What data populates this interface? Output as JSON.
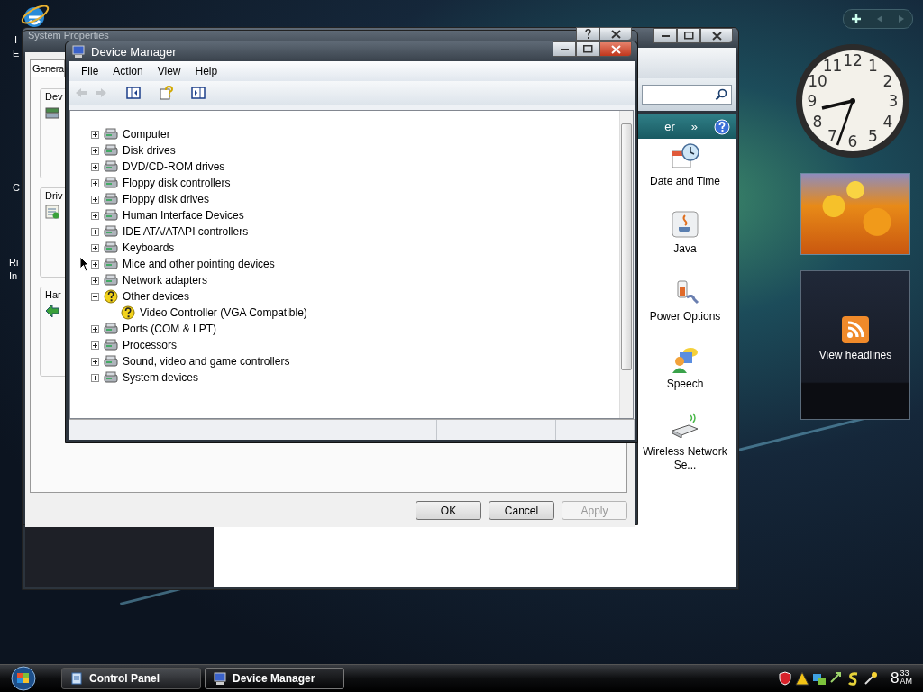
{
  "desktop": {
    "icon_labels": [
      "I",
      "E",
      "C",
      "Ri",
      "In"
    ]
  },
  "control_panel": {
    "header_text": "er",
    "header_chevron": "»",
    "items": [
      "Date and Time",
      "Java",
      "Power Options",
      "Speech",
      "Wireless Network Se..."
    ]
  },
  "system_properties": {
    "title": "System Properties",
    "tabs": [
      {
        "label": "Genera",
        "selected": true
      }
    ],
    "groups": [
      "Dev",
      "Driv",
      "Har"
    ],
    "buttons": [
      {
        "label": "OK",
        "disabled": false
      },
      {
        "label": "Cancel",
        "disabled": false
      },
      {
        "label": "Apply",
        "disabled": true
      }
    ]
  },
  "device_manager": {
    "title": "Device Manager",
    "menu": [
      "File",
      "Action",
      "View",
      "Help"
    ],
    "tree": [
      {
        "label": "Computer",
        "kind": "device",
        "expanded": false
      },
      {
        "label": "Disk drives",
        "kind": "device",
        "expanded": false
      },
      {
        "label": "DVD/CD-ROM drives",
        "kind": "device",
        "expanded": false
      },
      {
        "label": "Floppy disk controllers",
        "kind": "device",
        "expanded": false
      },
      {
        "label": "Floppy disk drives",
        "kind": "device",
        "expanded": false
      },
      {
        "label": "Human Interface Devices",
        "kind": "device",
        "expanded": false
      },
      {
        "label": "IDE ATA/ATAPI controllers",
        "kind": "device",
        "expanded": false
      },
      {
        "label": "Keyboards",
        "kind": "device",
        "expanded": false
      },
      {
        "label": "Mice and other pointing devices",
        "kind": "device",
        "expanded": false
      },
      {
        "label": "Network adapters",
        "kind": "device",
        "expanded": false
      },
      {
        "label": "Other devices",
        "kind": "unknown",
        "expanded": true,
        "children": [
          {
            "label": "Video Controller (VGA Compatible)",
            "kind": "unknown"
          }
        ]
      },
      {
        "label": "Ports (COM & LPT)",
        "kind": "device",
        "expanded": false
      },
      {
        "label": "Processors",
        "kind": "device",
        "expanded": false
      },
      {
        "label": "Sound, video and game controllers",
        "kind": "device",
        "expanded": false
      },
      {
        "label": "System devices",
        "kind": "device",
        "expanded": false
      }
    ]
  },
  "gadgets": {
    "clock": {
      "numerals": [
        "11",
        "12",
        "1",
        "10",
        "2",
        "9",
        "3",
        "8",
        "4",
        "7",
        "6",
        "5"
      ]
    },
    "feed": {
      "label": "View headlines"
    }
  },
  "taskbar": {
    "buttons": [
      {
        "label": "Control Panel",
        "selected": false
      },
      {
        "label": "Device Manager",
        "selected": true
      }
    ],
    "clock": {
      "hour": "8",
      "minutes": "33",
      "period": "AM"
    }
  }
}
